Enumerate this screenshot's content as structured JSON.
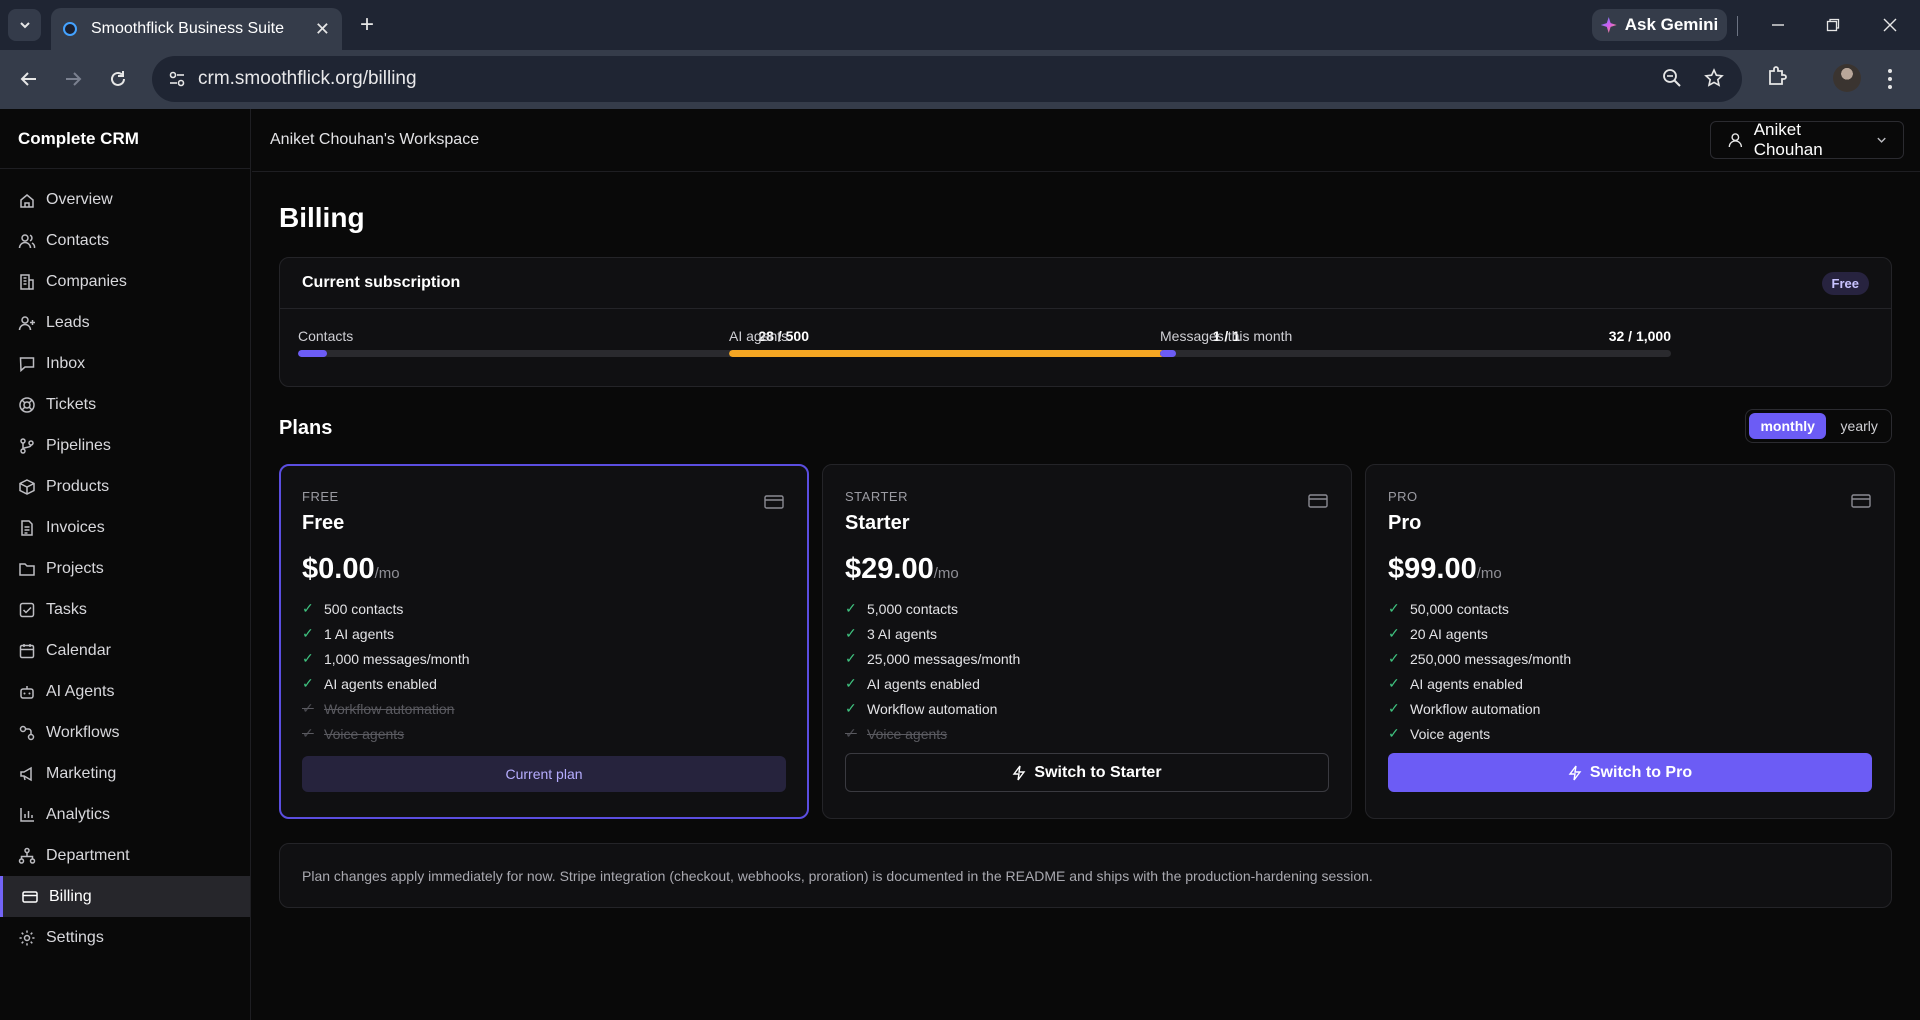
{
  "browser": {
    "tab_title": "Smoothflick Business Suite",
    "url": "crm.smoothflick.org/billing",
    "gemini_label": "Ask Gemini"
  },
  "app": {
    "brand": "Complete CRM",
    "workspace": "Aniket Chouhan's Workspace",
    "user_name": "Aniket Chouhan"
  },
  "sidebar": {
    "items": [
      {
        "label": "Overview",
        "icon": "home-icon"
      },
      {
        "label": "Contacts",
        "icon": "users-icon"
      },
      {
        "label": "Companies",
        "icon": "building-icon"
      },
      {
        "label": "Leads",
        "icon": "user-plus-icon"
      },
      {
        "label": "Inbox",
        "icon": "message-icon"
      },
      {
        "label": "Tickets",
        "icon": "lifebuoy-icon"
      },
      {
        "label": "Pipelines",
        "icon": "git-branch-icon"
      },
      {
        "label": "Products",
        "icon": "package-icon"
      },
      {
        "label": "Invoices",
        "icon": "file-text-icon"
      },
      {
        "label": "Projects",
        "icon": "folder-icon"
      },
      {
        "label": "Tasks",
        "icon": "check-square-icon"
      },
      {
        "label": "Calendar",
        "icon": "calendar-icon"
      },
      {
        "label": "AI Agents",
        "icon": "bot-icon"
      },
      {
        "label": "Workflows",
        "icon": "workflow-icon"
      },
      {
        "label": "Marketing",
        "icon": "megaphone-icon"
      },
      {
        "label": "Analytics",
        "icon": "bar-chart-icon"
      },
      {
        "label": "Department",
        "icon": "network-icon"
      },
      {
        "label": "Billing",
        "icon": "credit-card-icon",
        "active": true
      },
      {
        "label": "Settings",
        "icon": "gear-icon"
      }
    ]
  },
  "page": {
    "title": "Billing",
    "subscription": {
      "title": "Current subscription",
      "badge": "Free",
      "usage": [
        {
          "label": "Contacts",
          "value": "28 / 500",
          "fraction": 0.056,
          "color": "#6c5cf5"
        },
        {
          "label": "AI agents",
          "value": "1 / 1",
          "fraction": 1.0,
          "color": "#f5a623"
        },
        {
          "label": "Messages this month",
          "value": "32 / 1,000",
          "fraction": 0.032,
          "color": "#6c5cf5"
        }
      ]
    },
    "plans_title": "Plans",
    "billing_toggle": {
      "monthly": "monthly",
      "yearly": "yearly",
      "selected": "monthly"
    },
    "plans": [
      {
        "tier": "FREE",
        "name": "Free",
        "price": "$0.00",
        "per": "/mo",
        "features": [
          {
            "text": "500 contacts",
            "included": true
          },
          {
            "text": "1 AI agents",
            "included": true
          },
          {
            "text": "1,000 messages/month",
            "included": true
          },
          {
            "text": "AI agents enabled",
            "included": true
          },
          {
            "text": "Workflow automation",
            "included": false
          },
          {
            "text": "Voice agents",
            "included": false
          }
        ],
        "button": "Current plan",
        "current": true
      },
      {
        "tier": "STARTER",
        "name": "Starter",
        "price": "$29.00",
        "per": "/mo",
        "features": [
          {
            "text": "5,000 contacts",
            "included": true
          },
          {
            "text": "3 AI agents",
            "included": true
          },
          {
            "text": "25,000 messages/month",
            "included": true
          },
          {
            "text": "AI agents enabled",
            "included": true
          },
          {
            "text": "Workflow automation",
            "included": true
          },
          {
            "text": "Voice agents",
            "included": false
          }
        ],
        "button": "Switch to Starter"
      },
      {
        "tier": "PRO",
        "name": "Pro",
        "price": "$99.00",
        "per": "/mo",
        "features": [
          {
            "text": "50,000 contacts",
            "included": true
          },
          {
            "text": "20 AI agents",
            "included": true
          },
          {
            "text": "250,000 messages/month",
            "included": true
          },
          {
            "text": "AI agents enabled",
            "included": true
          },
          {
            "text": "Workflow automation",
            "included": true
          },
          {
            "text": "Voice agents",
            "included": true
          }
        ],
        "button": "Switch to Pro"
      }
    ],
    "note": "Plan changes apply immediately for now. Stripe integration (checkout, webhooks, proration) is documented in the README and ships with the production-hardening session."
  }
}
